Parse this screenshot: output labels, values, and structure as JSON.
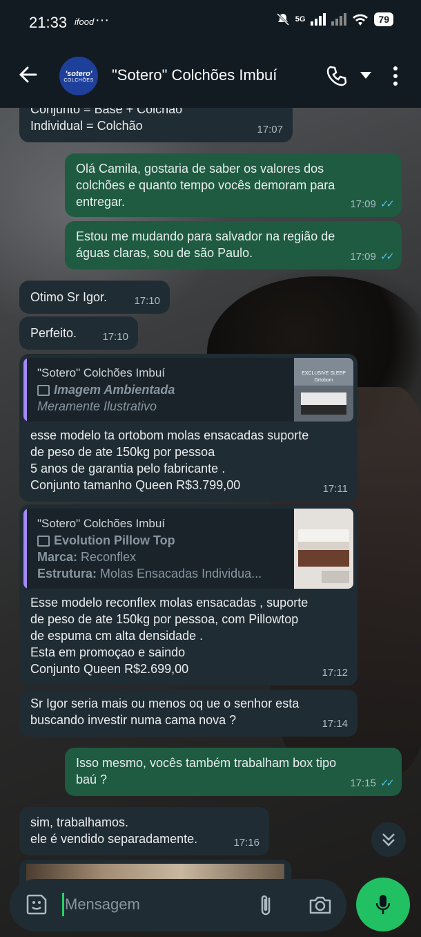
{
  "status_bar": {
    "time": "21:33",
    "extra_icon": "ifood",
    "more": "···",
    "network": "5G",
    "battery": "79"
  },
  "header": {
    "title": "\"Sotero\" Colchões Imbuí",
    "avatar_line1": "'sotero'",
    "avatar_line2": "COLCHÕES"
  },
  "messages": [
    {
      "dir": "in",
      "lines": [
        "Conjunto = Base + Colchão",
        "Individual = Colchão"
      ],
      "time": "17:07"
    },
    {
      "dir": "out",
      "lines": [
        "Olá Camila, gostaria de saber os valores dos",
        "colchões e quanto tempo vocês demoram para",
        "entregar."
      ],
      "time": "17:09",
      "read": true
    },
    {
      "dir": "out",
      "lines": [
        "Estou me mudando para salvador na região de",
        "águas claras, sou de são Paulo."
      ],
      "time": "17:09",
      "read": true
    },
    {
      "dir": "in",
      "lines": [
        "Otimo Sr Igor."
      ],
      "time": "17:10"
    },
    {
      "dir": "in",
      "lines": [
        "Perfeito."
      ],
      "time": "17:10"
    },
    {
      "dir": "in",
      "quote": {
        "name": "\"Sotero\" Colchões Imbuí",
        "line2": "Imagem Ambientada",
        "line3": "Meramente Ilustrativo"
      },
      "lines": [
        "esse modelo ta ortobom molas ensacadas suporte",
        "de peso de ate 150kg por pessoa",
        "5 anos de garantia pelo fabricante .",
        "Conjunto tamanho Queen R$3.799,00"
      ],
      "time": "17:11"
    },
    {
      "dir": "in",
      "quote": {
        "name": "\"Sotero\" Colchões Imbuí",
        "line2": "Evolution Pillow Top",
        "line3_label": "Marca:",
        "line3_value": " Reconflex",
        "line4_label": "Estrutura:",
        "line4_value": " Molas Ensacadas Individua..."
      },
      "lines": [
        "Esse modelo reconflex molas ensacadas , suporte",
        "de peso de ate 150kg por pessoa, com Pillowtop",
        "de espuma cm alta densidade .",
        "Esta em promoçao e saindo",
        "Conjunto Queen R$2.699,00"
      ],
      "time": "17:12"
    },
    {
      "dir": "in",
      "lines": [
        "Sr Igor seria mais ou menos oq ue o senhor esta",
        "buscando investir numa cama nova ?"
      ],
      "time": "17:14"
    },
    {
      "dir": "out",
      "lines": [
        "Isso mesmo, vocês também trabalham box tipo",
        "baú ?"
      ],
      "time": "17:15",
      "read": true
    },
    {
      "dir": "in",
      "lines": [
        "sim, trabalhamos.",
        "ele é vendido separadamente."
      ],
      "time": "17:16"
    }
  ],
  "thumb1_text": "EXCLUSIVE SLEEP",
  "thumb1_brand": "Ortobom",
  "composer": {
    "placeholder": "Mensagem"
  },
  "colors": {
    "incoming": "#202c33",
    "outgoing": "#1e5b41",
    "accent": "#21c063",
    "read_check": "#53bdeb",
    "quote_bar": "#a389f5"
  }
}
